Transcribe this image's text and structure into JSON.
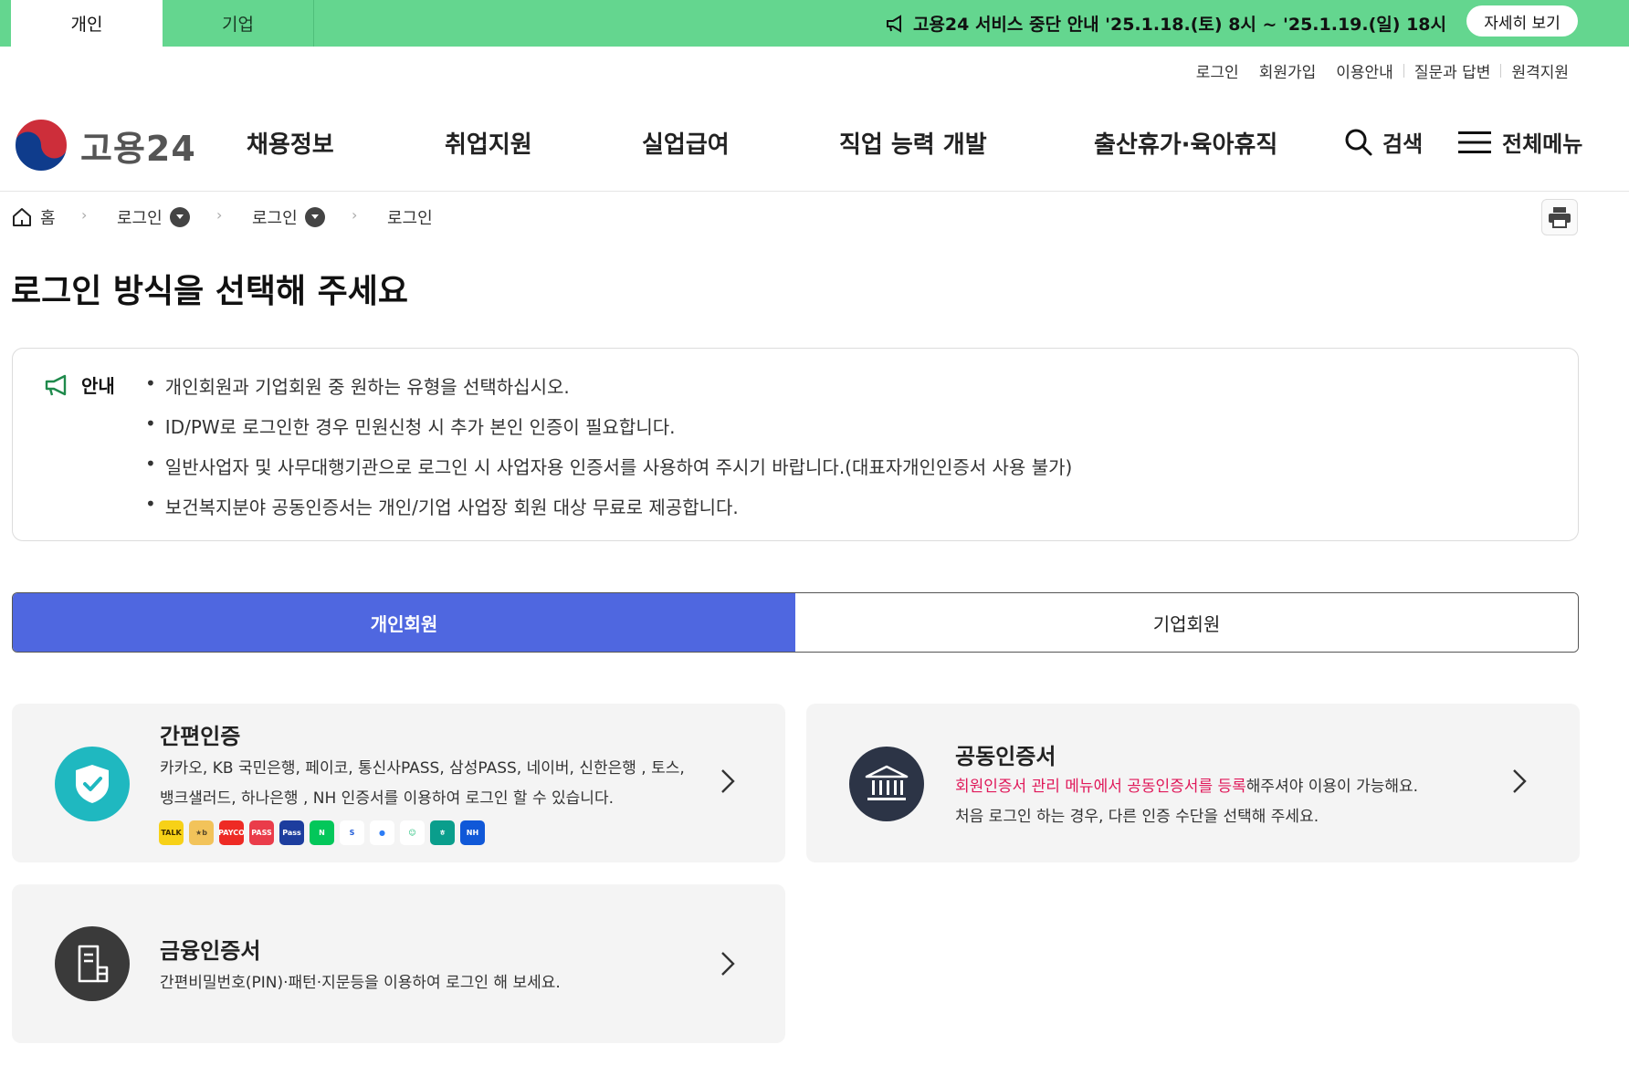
{
  "topbar": {
    "tabs": [
      {
        "label": "개인",
        "active": true
      },
      {
        "label": "기업",
        "active": false
      }
    ],
    "notice_text": "고용24 서비스 중단 안내 '25.1.18.(토) 8시 ~ '25.1.19.(일) 18시",
    "notice_button": "자세히 보기",
    "color": "#64d68f"
  },
  "util_links": [
    "로그인",
    "회원가입",
    "이용안내",
    "질문과 답변",
    "원격지원"
  ],
  "header": {
    "logo_text": "고용24",
    "nav": [
      "채용정보",
      "취업지원",
      "실업급여",
      "직업 능력 개발",
      "출산휴가·육아휴직"
    ],
    "search_label": "검색",
    "menu_label": "전체메뉴"
  },
  "breadcrumb": {
    "home": "홈",
    "items": [
      "로그인",
      "로그인",
      "로그인"
    ]
  },
  "page_title": "로그인 방식을 선택해 주세요",
  "info": {
    "heading": "안내",
    "items": [
      "개인회원과 기업회원 중 원하는 유형을 선택하십시오.",
      "ID/PW로 로그인한 경우 민원신청 시 추가 본인 인증이 필요합니다.",
      "일반사업자 및 사무대행기관으로 로그인 시 사업자용 인증서를 사용하여 주시기 바랍니다.(대표자개인인증서 사용 불가)",
      "보건복지분야 공동인증서는 개인/기업 사업장 회원 대상 무료로 제공합니다."
    ]
  },
  "member_tabs": [
    {
      "label": "개인회원",
      "active": true
    },
    {
      "label": "기업회원",
      "active": false
    }
  ],
  "cards": {
    "simple": {
      "title": "간편인증",
      "desc_line1": "카카오, KB 국민은행, 페이코, 통신사PASS, 삼성PASS, 네이버, 신한은행 , 토스,",
      "desc_line2": "뱅크샐러드, 하나은행 , NH 인증서를 이용하여 로그인 할 수 있습니다.",
      "icon": "shield-check-icon",
      "icon_color": "#1fb8c0",
      "badges": [
        {
          "name": "kakao",
          "text": "TALK",
          "color": "#f7d117",
          "fg": "#3a2a00"
        },
        {
          "name": "kb",
          "text": "★b",
          "color": "#f2c35a",
          "fg": "#5a4a2a"
        },
        {
          "name": "payco",
          "text": "PAYCO",
          "color": "#ee2a24",
          "fg": "#ffffff"
        },
        {
          "name": "pass",
          "text": "PASS",
          "color": "#ea3c4a",
          "fg": "#ffffff"
        },
        {
          "name": "samsung-pass",
          "text": "Pass",
          "color": "#1d3d9e",
          "fg": "#ffffff"
        },
        {
          "name": "naver",
          "text": "N",
          "color": "#03c75a",
          "fg": "#ffffff"
        },
        {
          "name": "shinhan",
          "text": "S",
          "color": "#ffffff",
          "fg": "#1f5bd8"
        },
        {
          "name": "toss",
          "text": "●",
          "color": "#ffffff",
          "fg": "#2d7df6"
        },
        {
          "name": "banksalad",
          "text": "☺",
          "color": "#ffffff",
          "fg": "#1fbf7a"
        },
        {
          "name": "hana",
          "text": "ㅎ",
          "color": "#0a9e8c",
          "fg": "#ffffff"
        },
        {
          "name": "nh",
          "text": "NH",
          "color": "#1058d8",
          "fg": "#ffffff"
        }
      ]
    },
    "joint": {
      "title": "공동인증서",
      "desc_highlight": "회원인증서 관리 메뉴에서 공동인증서를 등록",
      "desc_rest": "해주셔야 이용이 가능해요.",
      "desc_line2": "처음 로그인 하는 경우, 다른 인증 수단을 선택해 주세요.",
      "icon": "bank-building-icon",
      "icon_color": "#2c3446"
    },
    "finance": {
      "title": "금융인증서",
      "desc": "간편비밀번호(PIN)·패턴·지문등을 이용하여 로그인 해 보세요.",
      "icon": "document-icon",
      "icon_color": "#3a3a3a"
    }
  },
  "colors": {
    "accent": "#4f67e0",
    "highlight": "#e0195a"
  }
}
